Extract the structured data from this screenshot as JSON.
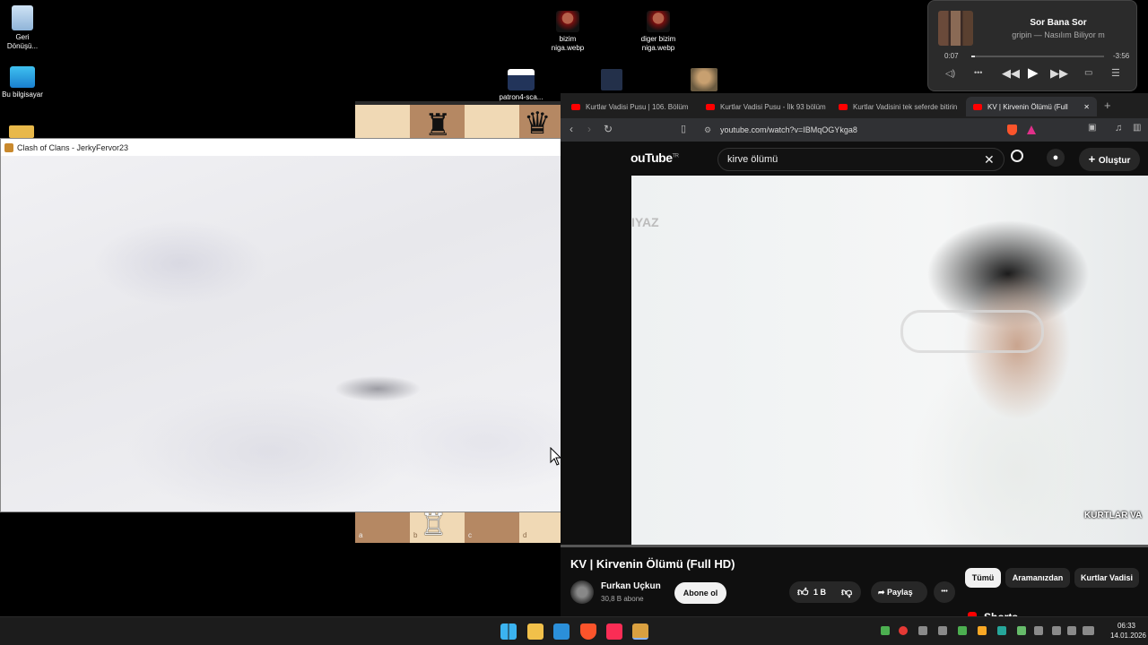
{
  "desktop": {
    "icons": [
      {
        "label": "Geri\nDönüşü..."
      },
      {
        "label": "Bu bilgisayar"
      },
      {
        "label": "bizim\nniga.webp"
      },
      {
        "label": "diger bizim\nniga.webp"
      },
      {
        "label": "patron4-sca..."
      }
    ]
  },
  "media_player": {
    "title": "Sor Bana Sor",
    "subtitle": "gripin — Nasılım Biliyor m",
    "elapsed": "0:07",
    "remaining": "-3:56",
    "progress": 0.03
  },
  "clash_window": {
    "title": "Clash of Clans - JerkyFervor23",
    "minimize": "–",
    "maximize": "☐",
    "close": "✕"
  },
  "chess": {
    "file_labels": [
      "a",
      "b",
      "c",
      "d"
    ]
  },
  "browser": {
    "tabs": [
      {
        "label": "Kurtlar Vadisi Pusu | 106. Bölüm"
      },
      {
        "label": "Kurtlar Vadisi Pusu - İlk 93 bölüm"
      },
      {
        "label": "Kurtlar Vadisini tek seferde bitirin"
      },
      {
        "label": "KV | Kirvenin Ölümü (Full"
      }
    ],
    "new_tab": "+",
    "close_tab": "✕",
    "url": "youtube.com/watch?v=IBMqOGYkga8"
  },
  "youtube": {
    "logo_text": "ouTube",
    "logo_region": "TR",
    "search_query": "kirve ölümü",
    "create_label": "Oluştur",
    "video_watermark": "IYAZ",
    "video_caption": "KURTLAR VA",
    "video_title": "KV | Kirvenin Ölümü (Full HD)",
    "channel_name": "Furkan Uçkun",
    "subscribers": "30,8 B abone",
    "subscribe_label": "Abone ol",
    "likes": "1 B",
    "share_label": "Paylaş",
    "more_label": "•••",
    "chips": [
      "Tümü",
      "Aramanızdan",
      "Kurtlar Vadisi"
    ],
    "shorts_label": "Shorts"
  },
  "taskbar": {
    "time": "06:33",
    "date": "14.01.2026"
  }
}
